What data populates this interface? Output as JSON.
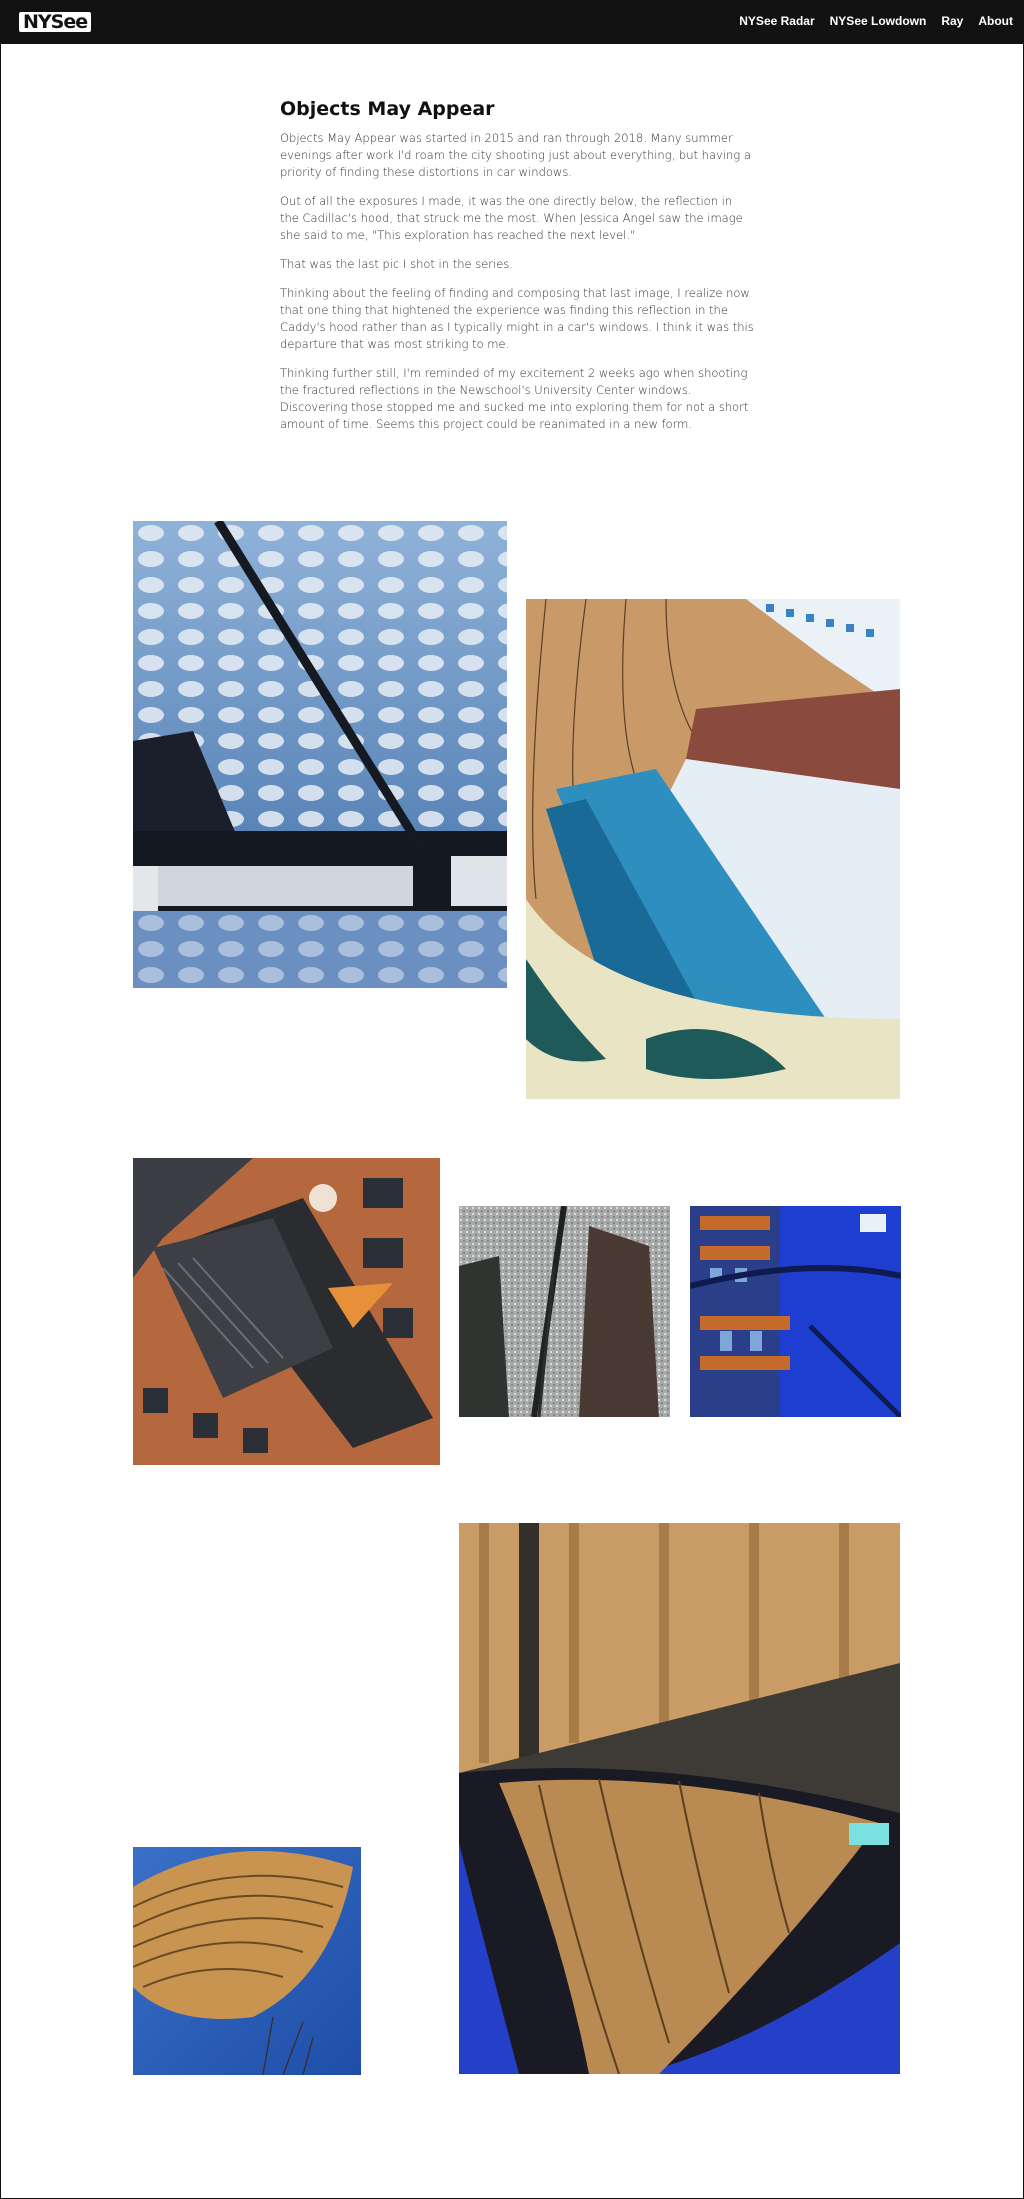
{
  "header": {
    "logo_text": "NYSee",
    "nav": [
      {
        "label": "NYSee Radar"
      },
      {
        "label": "NYSee Lowdown"
      },
      {
        "label": "Ray"
      },
      {
        "label": "About"
      }
    ]
  },
  "article": {
    "title": "Objects May Appear",
    "paragraphs": [
      "Objects May Appear was started in 2015 and ran through 2018. Many summer evenings after work I'd roam the city shooting just about everything, but having a priority of finding these distortions in car windows.",
      "Out of all the exposures I made, it was the one directly below, the reflection in the Cadillac's hood, that struck me the most. When Jessica Angel saw the image she said to me, \"This exploration has reached the next level.\"",
      "That was the last pic I shot in the series.",
      "Thinking about the feeling of finding and composing that last image, I realize now that one thing that hightened the experience was finding this reflection in the Caddy's hood rather than as I typically might in a car's windows. I think it was this departure that was most striking to me.",
      "Thinking further still, I'm reminded of my excitement 2 weeks ago when shooting the fractured reflections in the Newschool's University Center windows. Discovering those stopped me and sucked me into exploring them for not a short amount of time. Seems this project could be reanimated in a new form."
    ]
  },
  "gallery": {
    "photos": [
      {
        "subject": "cadillac-hood-cloud-reflection",
        "sky": "#5b86b8",
        "accent": "#1c2430"
      },
      {
        "subject": "curved-glass-building-reflection",
        "sky": "#c89a6a",
        "accent": "#2e8fb8"
      },
      {
        "subject": "brick-building-window-reflection",
        "sky": "#b5683e",
        "accent": "#2a2a2a"
      },
      {
        "subject": "rainy-windshield-wiper",
        "sky": "#9a9c9a",
        "accent": "#3a3a3a"
      },
      {
        "subject": "blue-car-building-reflection",
        "sky": "#1e3fd0",
        "accent": "#c46a2a"
      },
      {
        "subject": "curved-tower-blue-sky",
        "sky": "#2a5db8",
        "accent": "#d4a050"
      },
      {
        "subject": "car-roof-tan-building-reflection",
        "sky": "#c79a62",
        "accent": "#1f3fc0"
      }
    ]
  }
}
